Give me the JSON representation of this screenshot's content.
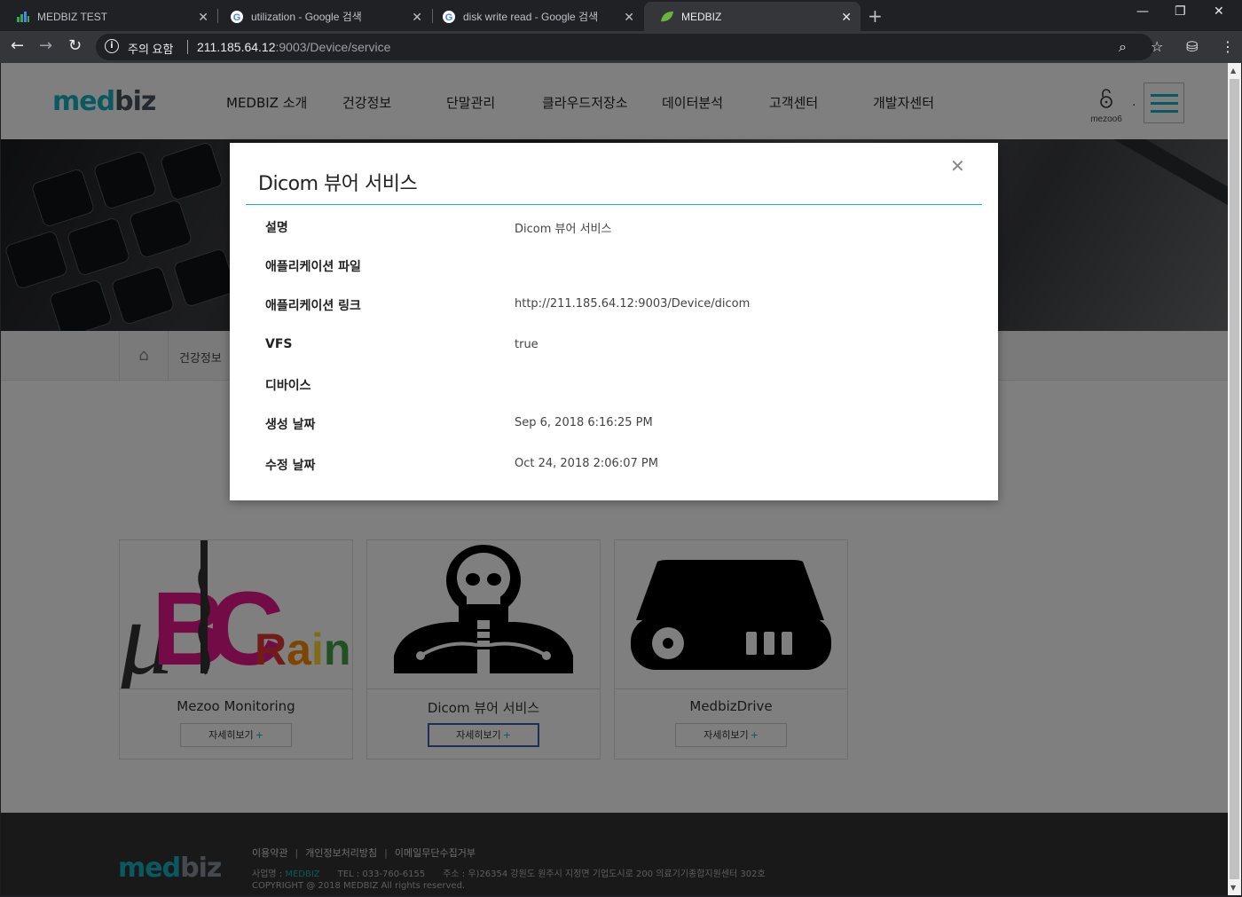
{
  "browser": {
    "tabs": [
      {
        "title": "MEDBIZ TEST",
        "icon": "bar-chart-icon",
        "active": false
      },
      {
        "title": "utilization - Google 검색",
        "icon": "google-icon",
        "active": false
      },
      {
        "title": "disk write read - Google 검색",
        "icon": "google-icon",
        "active": false
      },
      {
        "title": "MEDBIZ",
        "icon": "leaf-icon",
        "active": true
      }
    ],
    "security_label": "주의 요함",
    "url_host": "211.185.64.12",
    "url_rest": ":9003/Device/service"
  },
  "site": {
    "logo_a": "med",
    "logo_b": "biz",
    "nav": [
      "MEDBIZ 소개",
      "건강정보",
      "단말관리",
      "클라우드저장소",
      "데이터분석",
      "고객센터",
      "개발자센터"
    ],
    "user": "mezoo6",
    "user_dot": ".",
    "accent_color": "#17b3c1"
  },
  "breadcrumb": {
    "current": "건강정보"
  },
  "cards": [
    {
      "title": "Mezoo Monitoring",
      "button": "자세히보기",
      "image": "ubic-rainbow-logo"
    },
    {
      "title": "Dicom 뷰어 서비스",
      "button": "자세히보기",
      "image": "skeleton-xray-icon"
    },
    {
      "title": "MedbizDrive",
      "button": "자세히보기",
      "image": "hard-drive-icon"
    }
  ],
  "footer": {
    "links": [
      "이용약관",
      "개인정보처리방침",
      "이메일무단수집거부"
    ],
    "company_label": "사업명 : ",
    "company_name": "MEDBIZ",
    "tel": "TEL : 033-760-6155",
    "address": "주소 : 우)26354 강원도 원주시 지정면 기업도시로 200 의료기기종합지원센터 302호",
    "copyright": "COPYRIGHT @ 2018 MEDBIZ All rights reserved."
  },
  "modal": {
    "title": "Dicom 뷰어 서비스",
    "rows": [
      {
        "label": "설명",
        "value": "Dicom 뷰어 서비스"
      },
      {
        "label": "애플리케이션 파일",
        "value": ""
      },
      {
        "label": "애플리케이션 링크",
        "value": "http://211.185.64.12:9003/Device/dicom"
      },
      {
        "label": "VFS",
        "value": "true"
      },
      {
        "label": "디바이스",
        "value": ""
      },
      {
        "label": "생성 날짜",
        "value": "Sep 6, 2018 6:16:25 PM"
      },
      {
        "label": "수정 날짜",
        "value": "Oct 24, 2018 2:06:07 PM"
      }
    ]
  }
}
